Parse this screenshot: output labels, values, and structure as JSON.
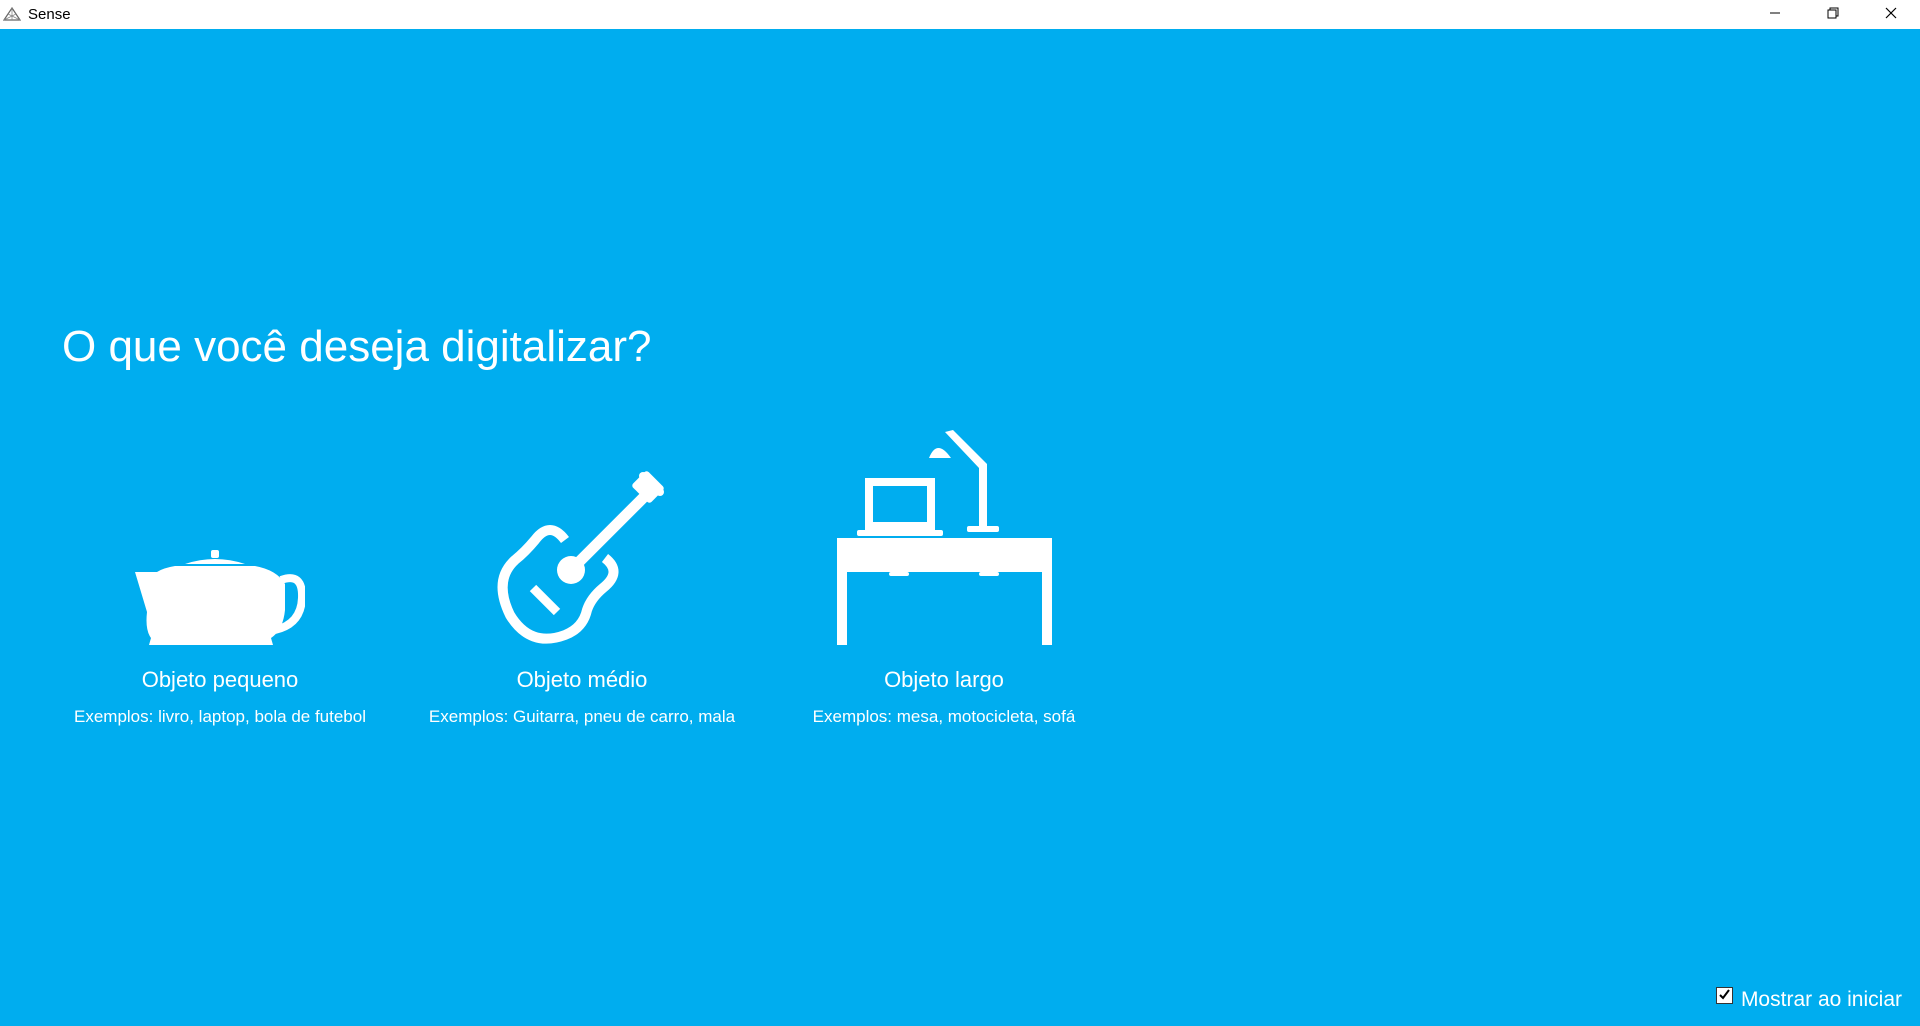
{
  "window": {
    "title": "Sense",
    "icon": "sense-app-icon",
    "controls": [
      "minimize-icon",
      "restore-icon",
      "close-icon"
    ]
  },
  "main": {
    "heading": "O que você deseja digitalizar?",
    "options": [
      {
        "icon": "teapot-icon",
        "label": "Objeto pequeno",
        "examples": "Exemplos: livro, laptop, bola de futebol"
      },
      {
        "icon": "guitar-icon",
        "label": "Objeto médio",
        "examples": "Exemplos: Guitarra, pneu de carro, mala"
      },
      {
        "icon": "desk-icon",
        "label": "Objeto largo",
        "examples": "Exemplos: mesa, motocicleta, sofá"
      }
    ]
  },
  "footer": {
    "show_on_start_label": "Mostrar ao iniciar",
    "show_on_start_checked": true
  },
  "colors": {
    "background": "#00adef",
    "foreground": "#ffffff"
  }
}
